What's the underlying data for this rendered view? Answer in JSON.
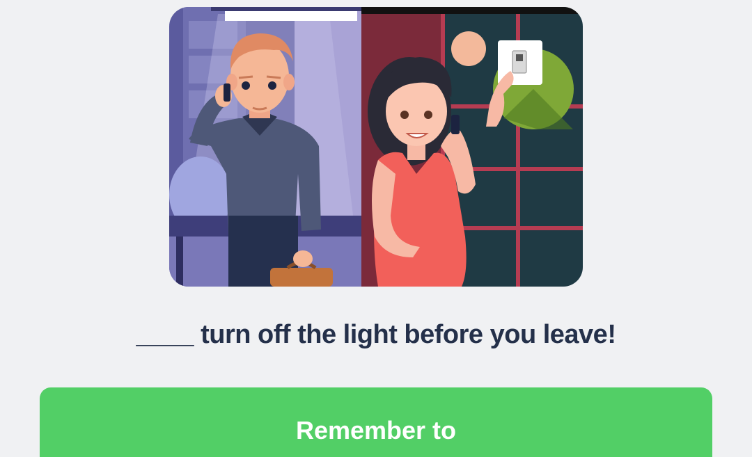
{
  "question": {
    "text": "____ turn off the light before you leave!"
  },
  "answers": [
    {
      "label": "Remember to"
    }
  ],
  "illustration": {
    "scene": "man-and-pregnant-woman-on-phone-with-light-switch",
    "accent_color": "#52cf66"
  }
}
